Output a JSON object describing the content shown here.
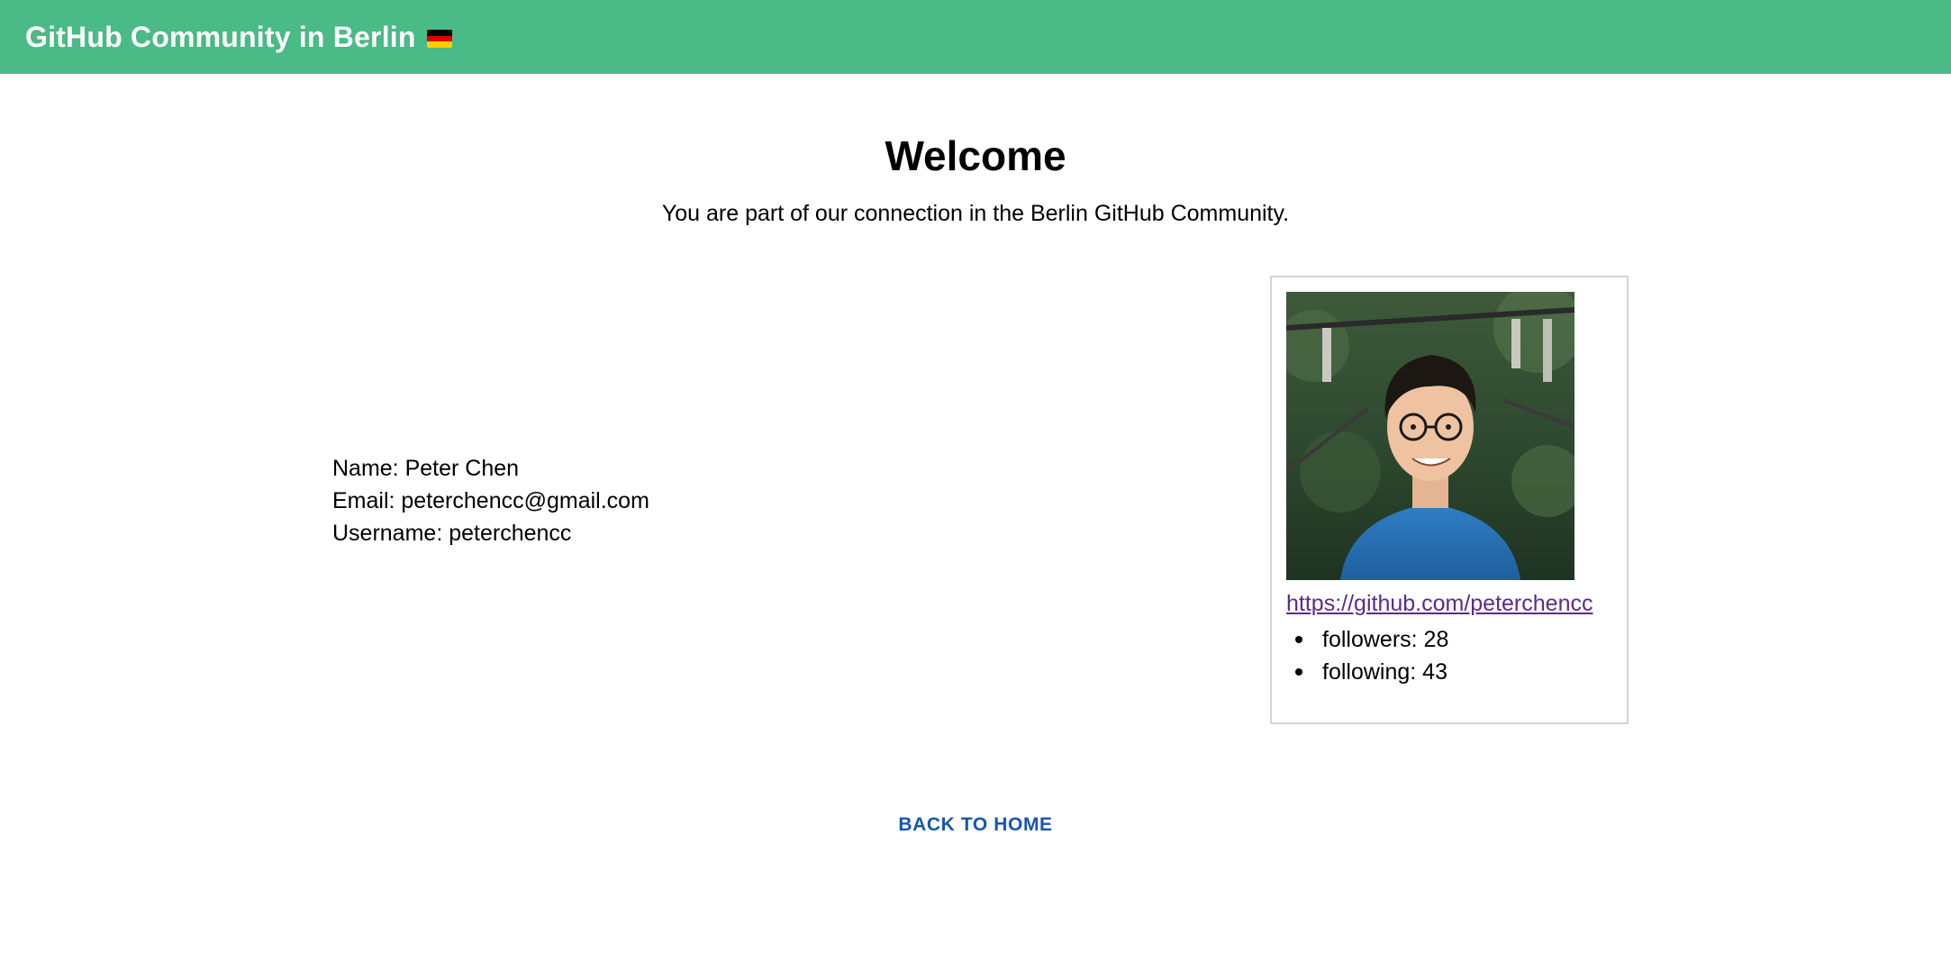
{
  "header": {
    "title": "GitHub Community in Berlin",
    "flag_icon": "germany-flag-icon",
    "background_color": "#4aba86"
  },
  "welcome": {
    "title": "Welcome",
    "subtitle": "You are part of our connection in the Berlin GitHub Community."
  },
  "user": {
    "name_line": "Name: Peter Chen",
    "email_line": "Email: peterchencc@gmail.com",
    "username_line": "Username: peterchencc"
  },
  "profile_card": {
    "avatar_icon": "profile-photo",
    "link": "https://github.com/peterchencc",
    "stats": [
      {
        "label": "followers: 28"
      },
      {
        "label": "following: 43"
      }
    ]
  },
  "actions": {
    "back_label": "BACK TO HOME",
    "back_color": "#1756b0"
  }
}
